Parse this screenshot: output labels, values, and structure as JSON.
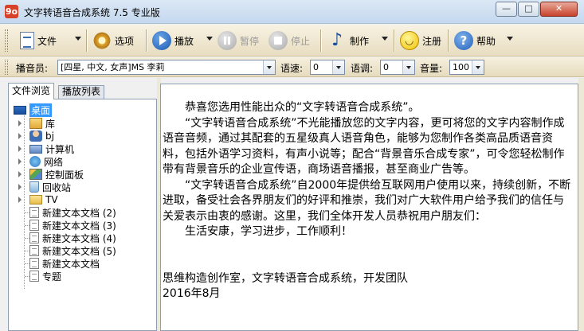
{
  "window": {
    "icon_text": "9o",
    "title": "文字转语音合成系统 7.5 专业版",
    "min_glyph": "—",
    "max_glyph": "□",
    "close_glyph": "✕"
  },
  "toolbar": {
    "file_label": "文件",
    "options_label": "选项",
    "play_label": "播放",
    "pause_label": "暂停",
    "stop_label": "停止",
    "make_label": "制作",
    "register_label": "注册",
    "help_label": "帮助",
    "note_glyph": "♪",
    "help_glyph": "?"
  },
  "settings": {
    "announcer_label": "播音员:",
    "announcer_value": "[四星, 中文, 女声]MS 李莉",
    "speed_label": "语速:",
    "speed_value": "0",
    "tone_label": "语调:",
    "tone_value": "0",
    "volume_label": "音量:",
    "volume_value": "100"
  },
  "left_panel": {
    "tabs": [
      "文件浏览",
      "播放列表"
    ],
    "active_tab": 0,
    "tree": [
      {
        "label": "桌面",
        "icon": "desktop-icon"
      },
      {
        "label": "库",
        "icon": "library-icon"
      },
      {
        "label": "bj",
        "icon": "user-folder-icon"
      },
      {
        "label": "计算机",
        "icon": "computer-icon"
      },
      {
        "label": "网络",
        "icon": "network-icon"
      },
      {
        "label": "控制面板",
        "icon": "control-panel-icon"
      },
      {
        "label": "回收站",
        "icon": "recycle-bin-icon"
      },
      {
        "label": "TV",
        "icon": "folder-icon"
      },
      {
        "label": "新建文本文档 (2)",
        "icon": "text-document-icon"
      },
      {
        "label": "新建文本文档 (3)",
        "icon": "text-document-icon"
      },
      {
        "label": "新建文本文档 (4)",
        "icon": "text-document-icon"
      },
      {
        "label": "新建文本文档 (5)",
        "icon": "text-document-icon"
      },
      {
        "label": "新建文本文档",
        "icon": "text-document-icon"
      },
      {
        "label": "专题",
        "icon": "text-document-icon"
      }
    ]
  },
  "text_pane": {
    "paragraphs": [
      "　　恭喜您选用性能出众的“文字转语音合成系统”。",
      "　　“文字转语音合成系统”不光能播放您的文字内容，更可将您的文字内容制作成语音音频，通过其配套的五星级真人语音角色，能够为您制作各类高品质语音资料，包括外语学习资料，有声小说等；配合“背景音乐合成专家”，可令您轻松制作带有背景音乐的企业宣传语，商场语音播报，甚至商业广告等。",
      "　　“文字转语音合成系统”自2000年提供给互联网用户使用以来，持续创新，不断进取，备受社会各界朋友们的好评和推崇，我们对广大软件用户给予我们的信任与关爱表示由衷的感谢。这里，我们全体开发人员恭祝用户朋友们：",
      "　　生活安康，学习进步，工作顺利！",
      "",
      "思维构造创作室，文字转语音合成系统，开发团队",
      "2016年8月"
    ]
  }
}
